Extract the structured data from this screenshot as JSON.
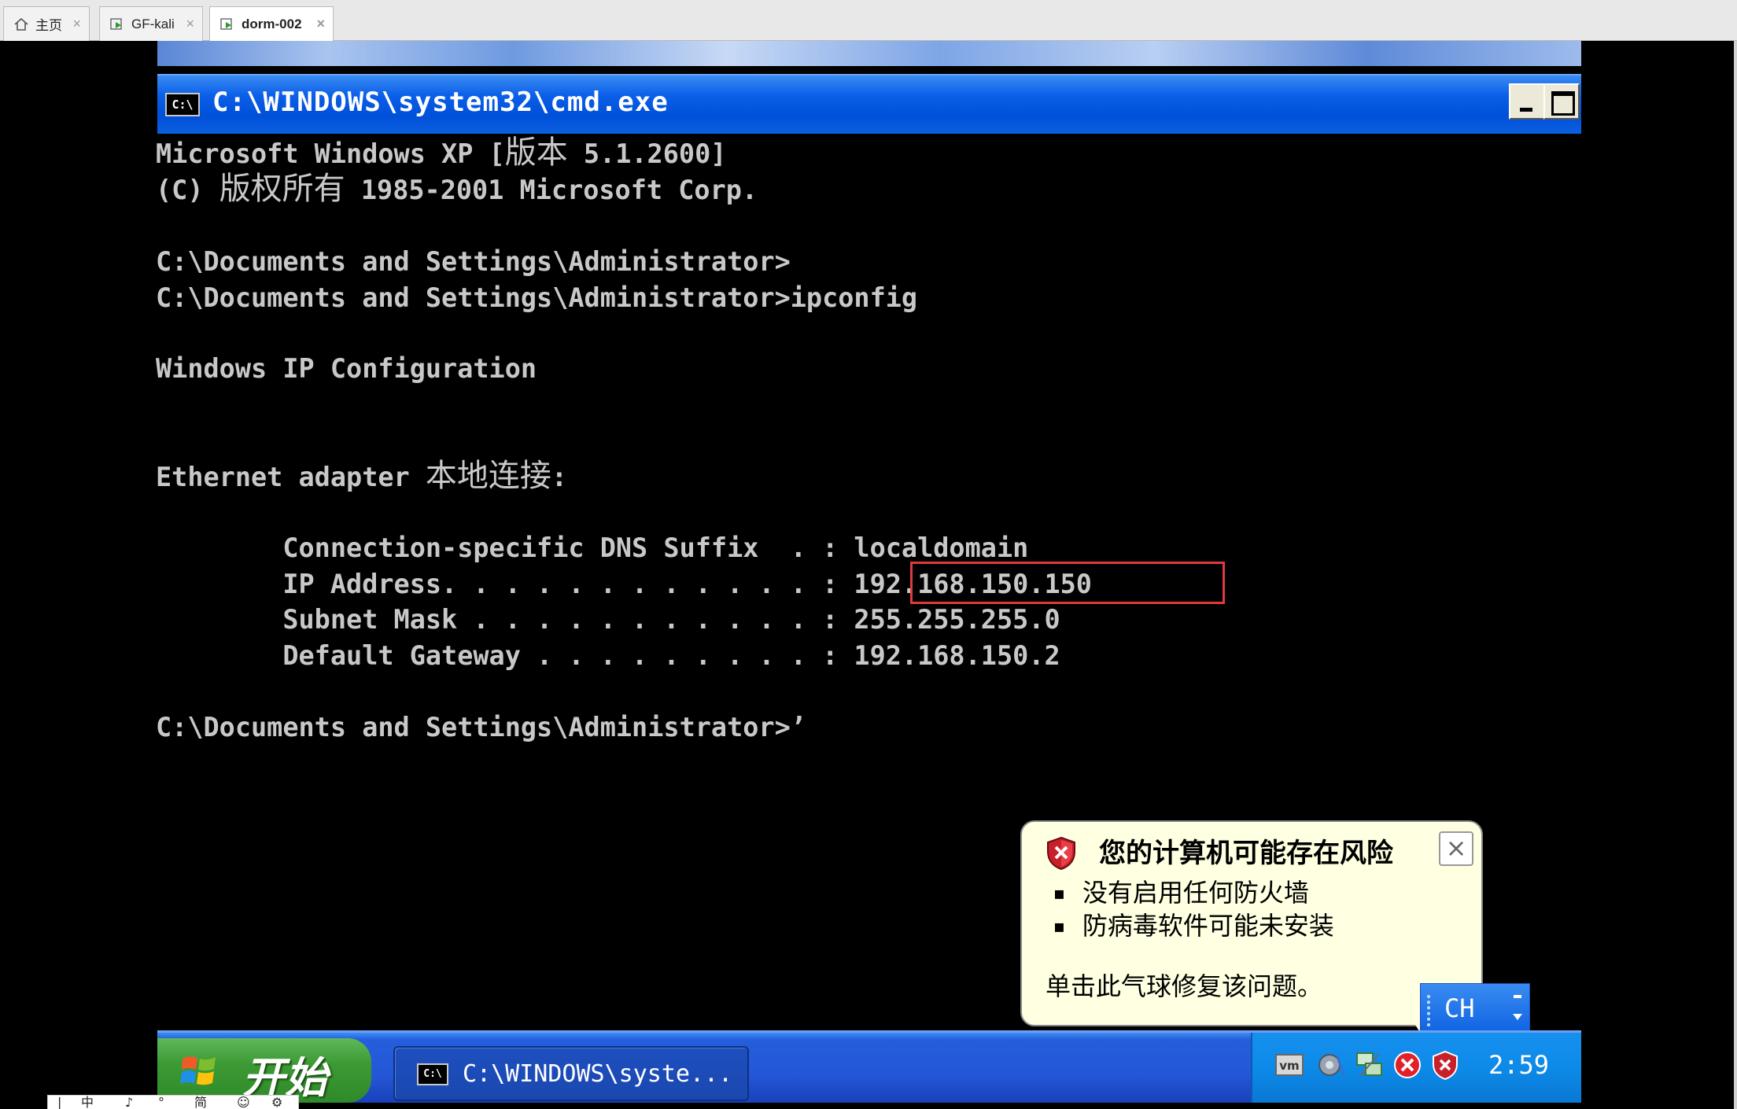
{
  "host": {
    "tabs": [
      {
        "label": "主页",
        "icon": "home-icon"
      },
      {
        "label": "GF-kali",
        "icon": "vm-running-icon"
      },
      {
        "label": "dorm-002",
        "icon": "vm-running-icon",
        "active": true
      }
    ],
    "tab_close_glyph": "×",
    "bottom_toolbar": [
      "|",
      "中",
      "♪",
      "°",
      "简",
      "☺",
      "⚙"
    ]
  },
  "cmd": {
    "icon_label": "C:\\",
    "title": "C:\\WINDOWS\\system32\\cmd.exe",
    "lines": {
      "l1a": "Microsoft Windows XP [",
      "l1b": "版本",
      "l1c": " 5.1.2600]",
      "l2a": "(C) ",
      "l2b": "版权所有",
      "l2c": " 1985-2001 Microsoft Corp.",
      "l4": "C:\\Documents and Settings\\Administrator>",
      "l5": "C:\\Documents and Settings\\Administrator>ipconfig",
      "l7": "Windows IP Configuration",
      "l10a": "Ethernet adapter ",
      "l10b": "本地连接",
      "l10c": ":",
      "l12": "        Connection-specific DNS Suffix  . : localdomain",
      "l13": "        IP Address. . . . . . . . . . . . : 192.168.150.150",
      "l14": "        Subnet Mask . . . . . . . . . . . : 255.255.255.0",
      "l15": "        Default Gateway . . . . . . . . . : 192.168.150.2",
      "l17": "C:\\Documents and Settings\\Administrator>’"
    },
    "highlight_color": "#e0393e"
  },
  "balloon": {
    "title": "您的计算机可能存在风险",
    "items": [
      "没有启用任何防火墙",
      "防病毒软件可能未安装"
    ],
    "message": "单击此气球修复该问题。",
    "close_glyph": "×"
  },
  "language_bar": {
    "label": "CH",
    "arrows": "▀\n▾"
  },
  "taskbar": {
    "start_label": "开始",
    "item_icon_label": "C:\\",
    "item_label": "C:\\WINDOWS\\syste...",
    "tray_icons": [
      "vmware-tools-icon",
      "volume-icon",
      "network-icon",
      "error-icon",
      "security-alert-icon"
    ],
    "clock": "2:59",
    "vm_icon_label": "vm"
  }
}
